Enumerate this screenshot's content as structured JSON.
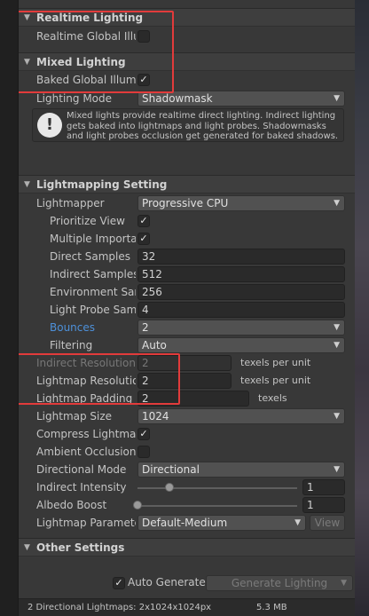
{
  "realtime": {
    "header": "Realtime Lighting",
    "gi_label": "Realtime Global Illum",
    "gi_checked": false
  },
  "mixed": {
    "header": "Mixed Lighting",
    "baked_label": "Baked Global Illumi",
    "baked_checked": true,
    "baked_mark": "✓",
    "mode_label": "Lighting Mode",
    "mode_value": "Shadowmask",
    "help_icon": "!",
    "help_text": "Mixed lights provide realtime direct lighting. Indirect lighting gets baked into lightmaps and light probes. Shadowmasks and light probes occlusion get generated for baked shadows. The Shadowmask Mode used at run time can be set in the Quality Settings panel."
  },
  "lightmapping": {
    "header": "Lightmapping Setting",
    "lightmapper_label": "Lightmapper",
    "lightmapper_value": "Progressive CPU",
    "prioritize_label": "Prioritize View",
    "prioritize_mark": "✓",
    "multiple_label": "Multiple Importan",
    "multiple_mark": "✓",
    "direct_label": "Direct Samples",
    "direct_value": "32",
    "indirect_label": "Indirect Samples",
    "indirect_value": "512",
    "env_label": "Environment Sam",
    "env_value": "256",
    "probe_label": "Light Probe Samp",
    "probe_value": "4",
    "bounces_label": "Bounces",
    "bounces_value": "2",
    "filtering_label": "Filtering",
    "filtering_value": "Auto",
    "indirect_res_label": "Indirect Resolution",
    "indirect_res_value": "2",
    "indirect_res_unit": "texels per unit",
    "lm_res_label": "Lightmap Resolutio",
    "lm_res_value": "2",
    "lm_res_unit": "texels per unit",
    "lm_pad_label": "Lightmap Padding",
    "lm_pad_value": "2",
    "lm_pad_unit": "texels",
    "lm_size_label": "Lightmap Size",
    "lm_size_value": "1024",
    "compress_label": "Compress Lightmap",
    "compress_mark": "✓",
    "ao_label": "Ambient Occlusion",
    "dir_mode_label": "Directional Mode",
    "dir_mode_value": "Directional",
    "indirect_int_label": "Indirect Intensity",
    "indirect_int_value": "1",
    "indirect_int_level": 0.2,
    "albedo_label": "Albedo Boost",
    "albedo_value": "1",
    "albedo_level": 0.0,
    "params_label": "Lightmap Paramete",
    "params_value": "Default-Medium",
    "view_button": "View"
  },
  "other": {
    "header": "Other Settings"
  },
  "footer": {
    "auto_mark": "✓",
    "auto_label": "Auto Generate",
    "generate_label": "Generate Lighting"
  },
  "status": {
    "lightmaps": "2 Directional Lightmaps: 2x1024x1024px",
    "size": "5.3 MB"
  },
  "colors": {
    "panel_bg": "#383838",
    "field_bg": "#2a2a2a",
    "link": "#4d90d9",
    "annotation_box": "#e23b3b"
  }
}
